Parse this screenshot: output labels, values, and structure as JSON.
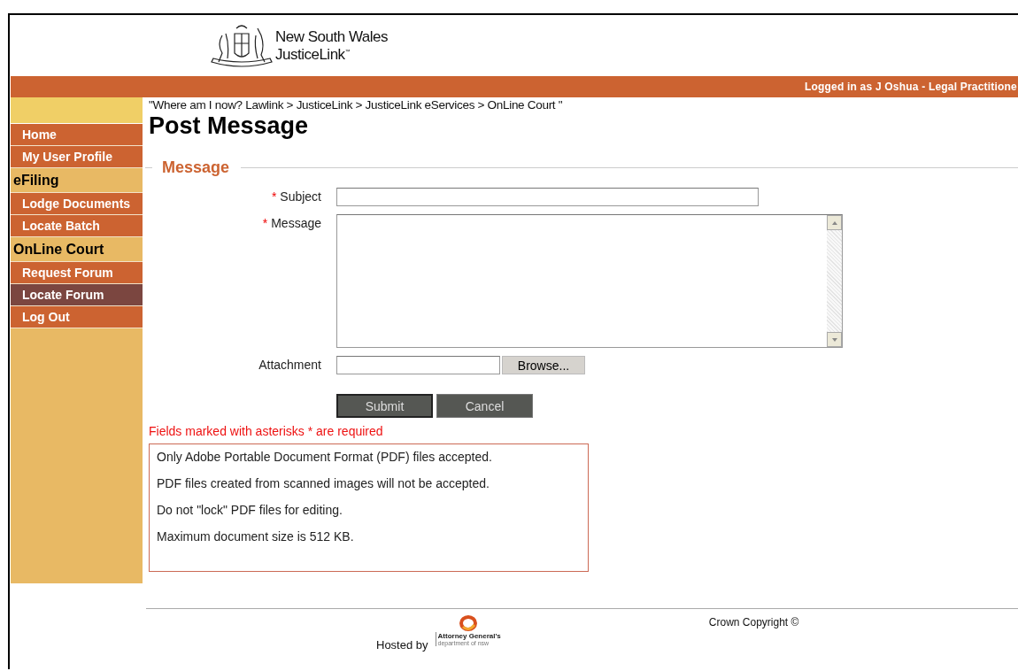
{
  "header": {
    "title": "New South Wales",
    "subtitle": "JusticeLink$^{™}$"
  },
  "user_bar": {
    "text": "Logged in as J Oshua - Legal Practitione"
  },
  "sidebar": {
    "items": [
      {
        "kind": "link",
        "label": "Home",
        "selected": false
      },
      {
        "kind": "link",
        "label": "My User Profile",
        "selected": false
      },
      {
        "kind": "heading",
        "label": "eFiling"
      },
      {
        "kind": "link",
        "label": "Lodge Documents",
        "selected": false
      },
      {
        "kind": "link",
        "label": "Locate Batch",
        "selected": false
      },
      {
        "kind": "heading",
        "label": "OnLine Court"
      },
      {
        "kind": "link",
        "label": "Request Forum",
        "selected": false
      },
      {
        "kind": "link",
        "label": "Locate Forum",
        "selected": true
      },
      {
        "kind": "link",
        "label": "Log Out",
        "selected": false
      }
    ]
  },
  "breadcrumb": "\"Where am I now? Lawlink > JusticeLink > JusticeLink eServices > OnLine Court \"",
  "page_title": "Post Message",
  "form": {
    "legend": "Message",
    "fields": [
      {
        "kind": "text",
        "label": "Subject",
        "required": true
      },
      {
        "kind": "textarea",
        "label": "Message",
        "required": true
      },
      {
        "kind": "file",
        "label": "Attachment",
        "required": false,
        "button": "Browse..."
      }
    ],
    "required_mark": "*",
    "buttons": [
      "Submit",
      "Cancel"
    ],
    "required_note": "Fields marked with asterisks * are required"
  },
  "notes": [
    "Only Adobe Portable Document Format (PDF) files accepted.",
    "PDF files created from scanned images will not be accepted.",
    "Do not \"lock\" PDF files for editing.",
    "Maximum document size is 512 KB."
  ],
  "footer": {
    "hosted_by": "Hosted by",
    "logo_title": "Attorney General's",
    "logo_subtitle": "department of nsw",
    "copyright": "Crown Copyright ©"
  }
}
